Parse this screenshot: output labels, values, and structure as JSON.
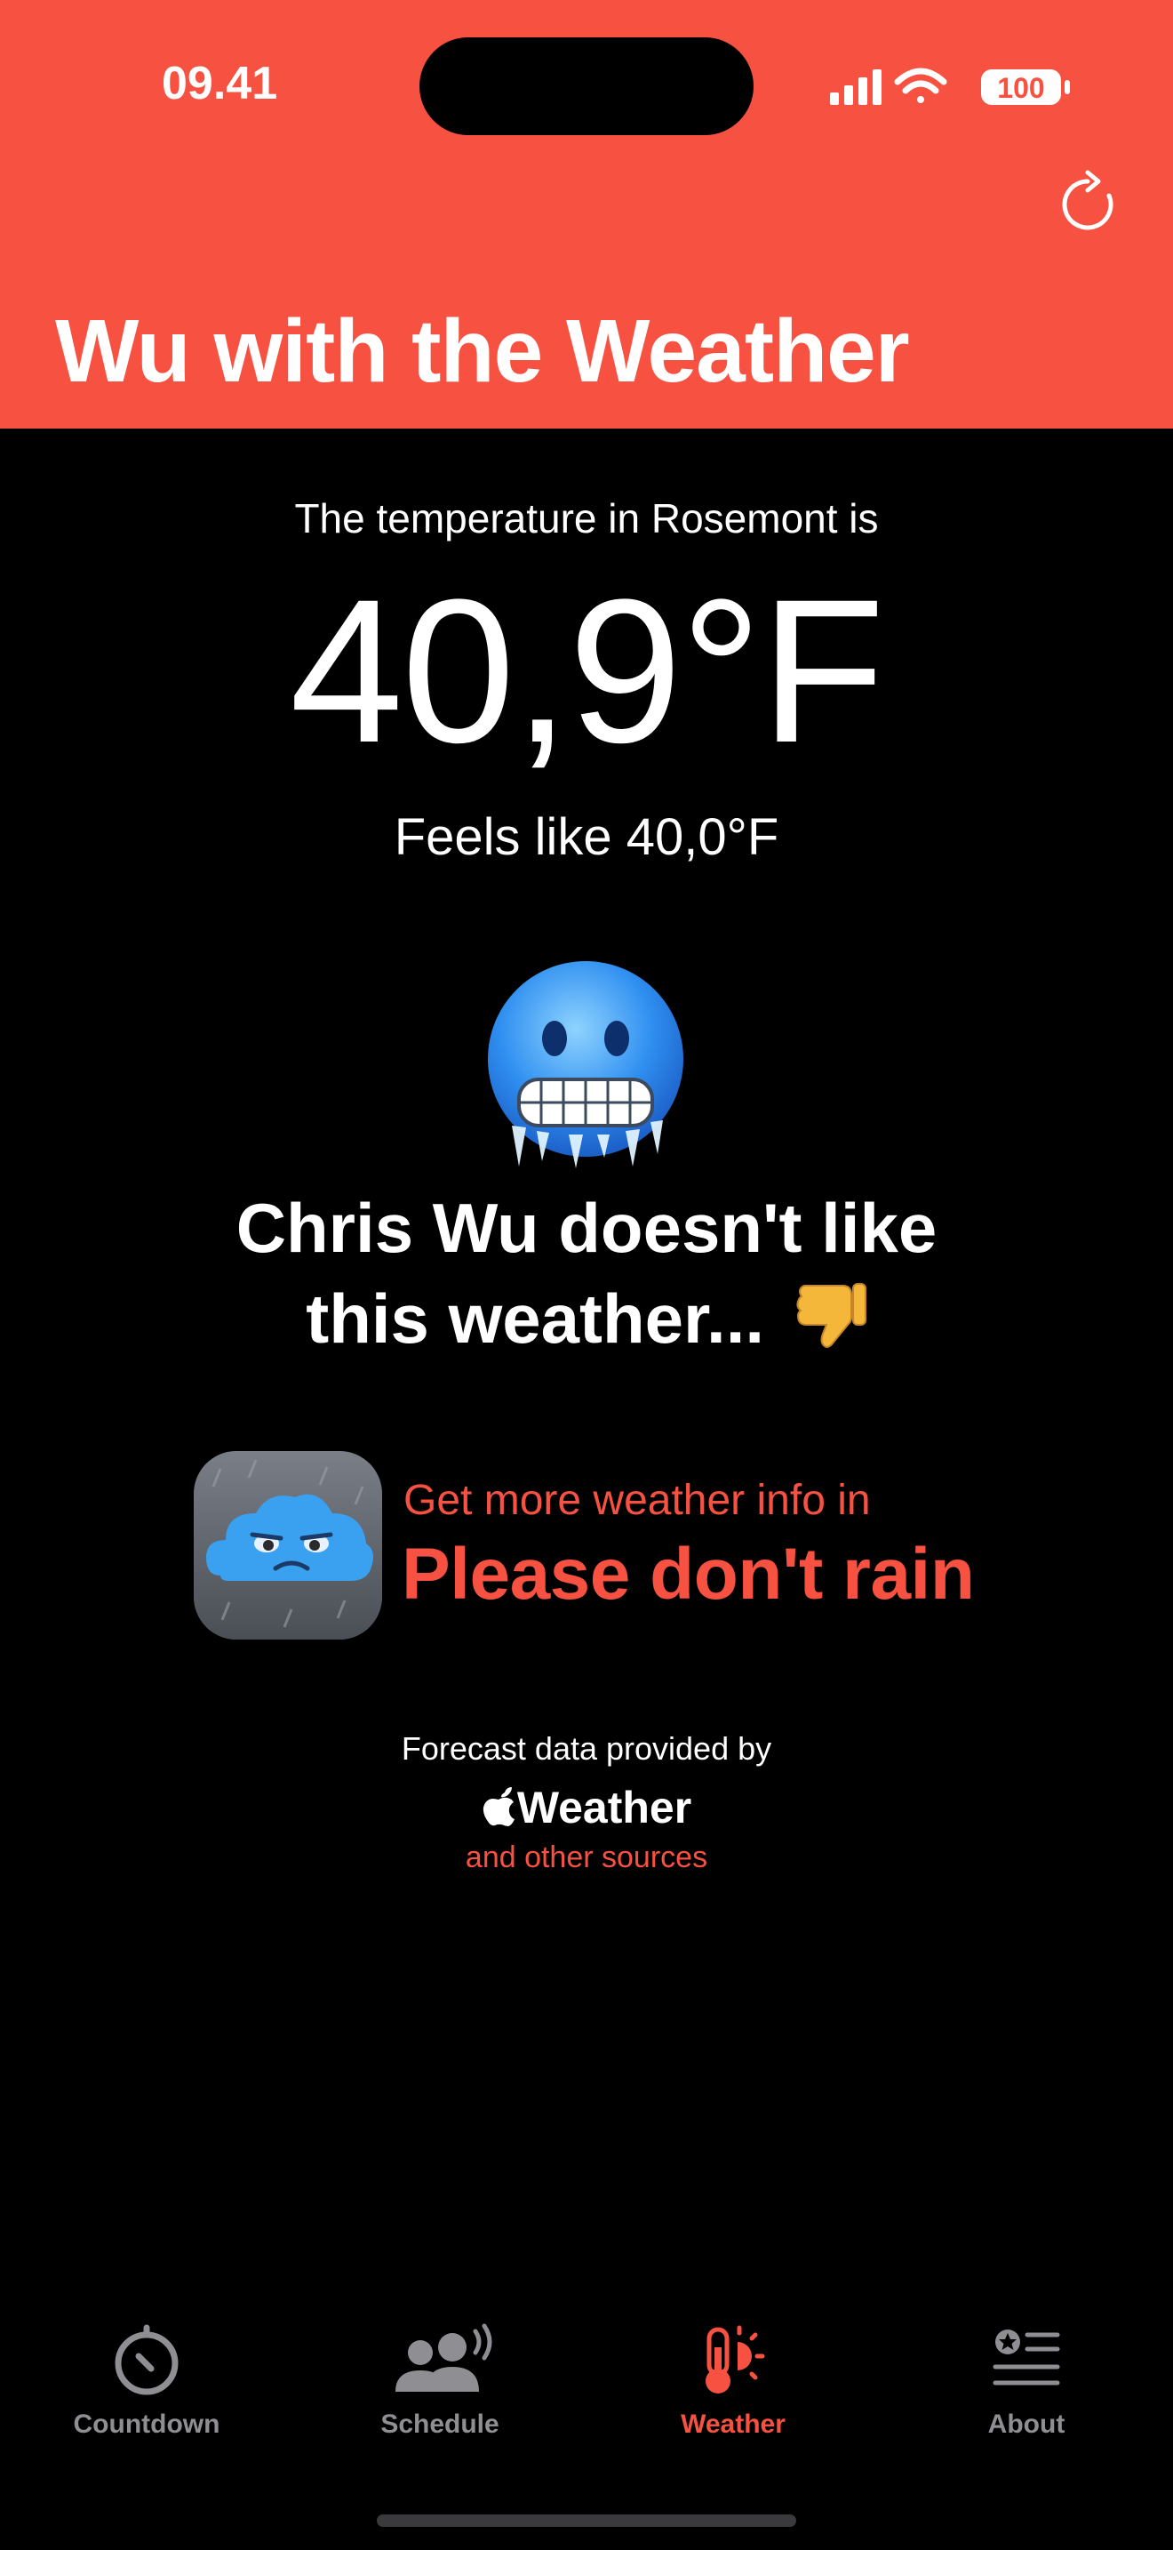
{
  "status_bar": {
    "time": "09.41",
    "battery": "100"
  },
  "header": {
    "title": "Wu with the Weather",
    "refresh_icon": "refresh-icon"
  },
  "weather": {
    "intro": "The temperature in Rosemont is",
    "temperature": "40,9°F",
    "feels_like": "Feels like 40,0°F",
    "verdict_line1": "Chris Wu doesn't like",
    "verdict_line2": "this weather..."
  },
  "promo": {
    "prefix": "Get more weather info in",
    "app_name": "Please don't rain"
  },
  "attribution": {
    "label": "Forecast data provided by",
    "brand": "Weather",
    "other_sources": "and other sources"
  },
  "tabs": [
    {
      "label": "Countdown",
      "icon": "timer-icon",
      "active": false
    },
    {
      "label": "Schedule",
      "icon": "people-icon",
      "active": false
    },
    {
      "label": "Weather",
      "icon": "thermometer-sun-icon",
      "active": true
    },
    {
      "label": "About",
      "icon": "list-star-icon",
      "active": false
    }
  ],
  "colors": {
    "accent": "#F75141",
    "inactive": "#8E8E93",
    "background": "#000000"
  }
}
